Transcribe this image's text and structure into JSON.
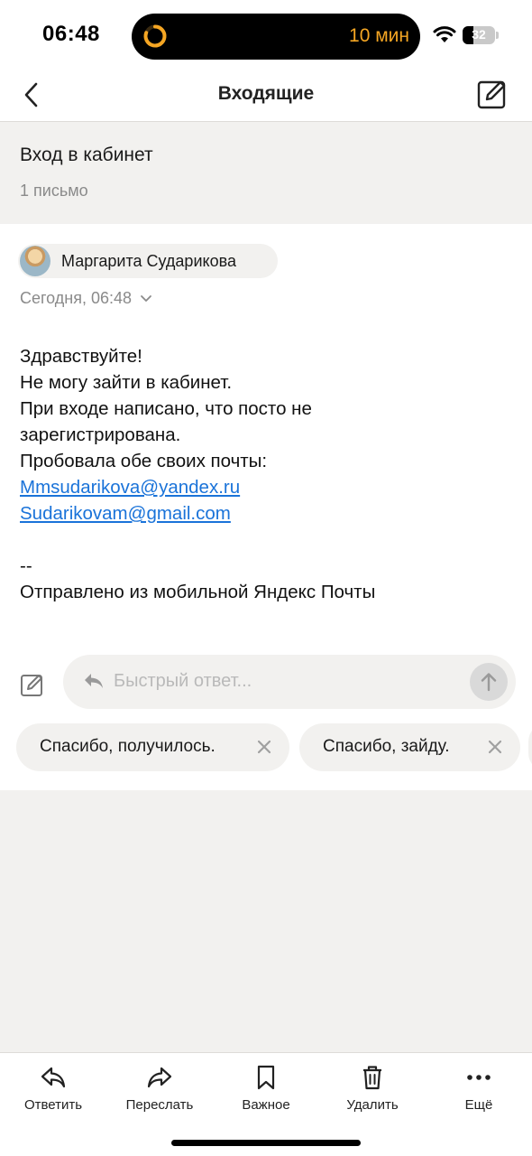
{
  "status_bar": {
    "time": "06:48",
    "timer": "10 мин",
    "battery": "32",
    "battery_level": 0.32,
    "accent_color": "#f5a623"
  },
  "nav": {
    "title": "Входящие",
    "back_icon": "chevron-left-icon",
    "compose_icon": "compose-icon"
  },
  "thread": {
    "subject": "Вход в кабинет",
    "count": "1 письмо"
  },
  "message": {
    "sender": "Маргарита Сударикова",
    "date": "Сегодня, 06:48",
    "body": {
      "line1": "Здравствуйте!",
      "line2": "Не могу зайти в кабинет.",
      "line3": "При входе написано, что посто не",
      "line4": "зарегистрирована.",
      "line5": "Пробовала обе своих почты:",
      "email1": "Mmsudarikova@yandex.ru",
      "email2": "Sudarikovam@gmail.com",
      "signature_sep": "--",
      "signature": "Отправлено из мобильной Яндекс Почты"
    },
    "link_color": "#1a73d9"
  },
  "quick_reply": {
    "placeholder": "Быстрый ответ...",
    "suggestions": [
      "Спасибо, получилось.",
      "Спасибо, зайду."
    ]
  },
  "toolbar": {
    "items": [
      {
        "label": "Ответить",
        "icon": "reply-icon"
      },
      {
        "label": "Переслать",
        "icon": "forward-icon"
      },
      {
        "label": "Важное",
        "icon": "bookmark-icon"
      },
      {
        "label": "Удалить",
        "icon": "trash-icon"
      },
      {
        "label": "Ещё",
        "icon": "more-icon"
      }
    ]
  }
}
